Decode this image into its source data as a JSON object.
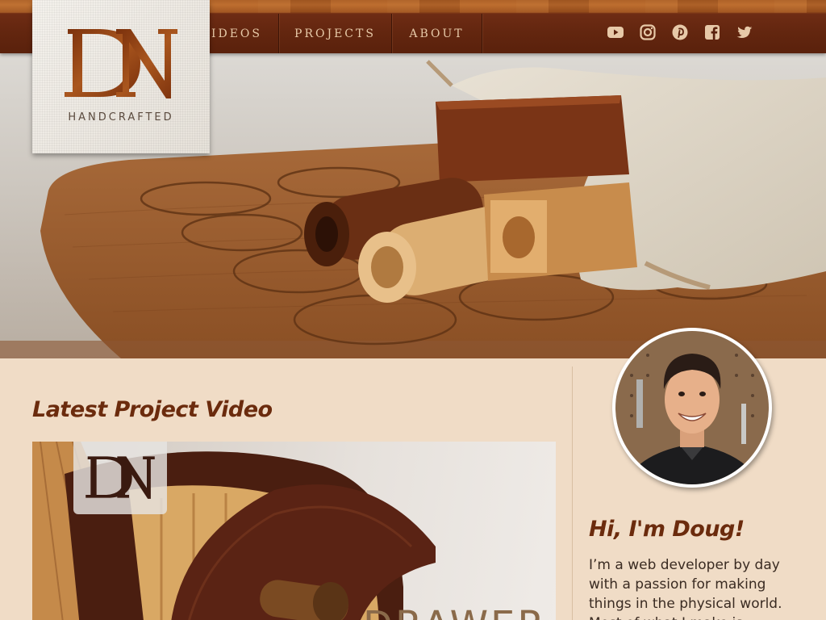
{
  "brand": {
    "logo_letters": "DN",
    "logo_subtitle": "HANDCRAFTED",
    "colors": {
      "header": "#63260f",
      "nav_text": "#e7c9a8",
      "heading": "#6b2b0d",
      "page_bg": "#f0dcc6",
      "logo_brown": "#8f3f12"
    }
  },
  "nav": {
    "items": [
      {
        "label": "Videos"
      },
      {
        "label": "Projects"
      },
      {
        "label": "About"
      }
    ]
  },
  "social": {
    "icons": [
      "youtube-icon",
      "instagram-icon",
      "pinterest-icon",
      "facebook-icon",
      "twitter-icon"
    ]
  },
  "hero": {
    "image": "wooden board with circular recesses, wooden tubes and canvas drawstring bag"
  },
  "main": {
    "latest_title": "Latest Project Video",
    "video": {
      "badge_letters": "DN",
      "caption": "DRAWER"
    }
  },
  "sidebar": {
    "greeting": "Hi, I'm Doug!",
    "bio": "I’m a web developer by day with a passion for making things in the physical world. Most of what I make is"
  }
}
